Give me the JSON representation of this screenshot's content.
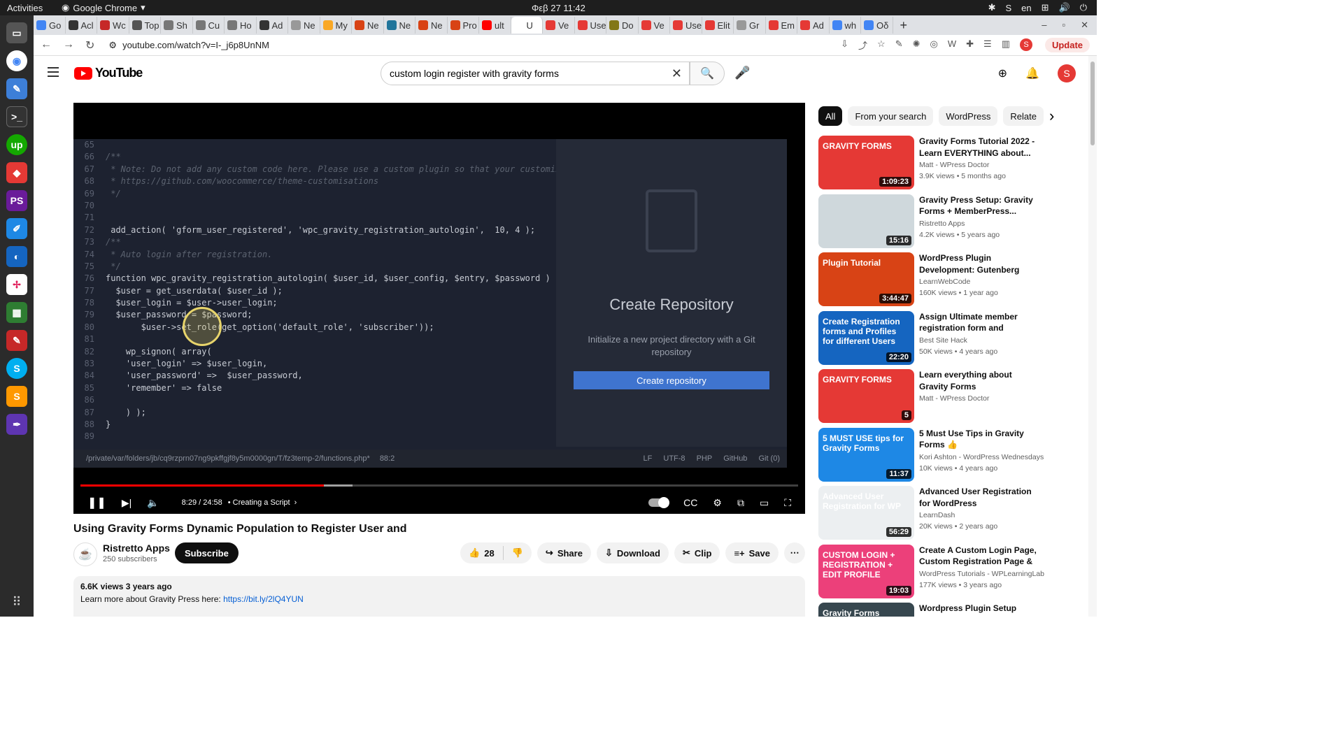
{
  "os": {
    "activities": "Activities",
    "app": "Google Chrome",
    "clock": "Φεβ 27  11:42",
    "lang": "en",
    "user_initial": "S"
  },
  "tabs": [
    {
      "label": "Go",
      "color": "#4285f4"
    },
    {
      "label": "Acl",
      "color": "#333"
    },
    {
      "label": "Wc",
      "color": "#c62828"
    },
    {
      "label": "Top",
      "color": "#555"
    },
    {
      "label": "Sh",
      "color": "#777"
    },
    {
      "label": "Cu",
      "color": "#777"
    },
    {
      "label": "Ho",
      "color": "#777"
    },
    {
      "label": "Ad",
      "color": "#333"
    },
    {
      "label": "Ne",
      "color": "#999"
    },
    {
      "label": "My",
      "color": "#f9a825"
    },
    {
      "label": "Ne",
      "color": "#d84315"
    },
    {
      "label": "Ne",
      "color": "#21759b"
    },
    {
      "label": "Ne",
      "color": "#d84315"
    },
    {
      "label": "Pro",
      "color": "#d84315"
    },
    {
      "label": "ult",
      "color": "#f00"
    },
    {
      "label": "U",
      "color": "#fff",
      "active": true
    },
    {
      "label": "Ve",
      "color": "#e53935"
    },
    {
      "label": "Use",
      "color": "#e53935"
    },
    {
      "label": "Do",
      "color": "#827717"
    },
    {
      "label": "Ve",
      "color": "#e53935"
    },
    {
      "label": "Use",
      "color": "#e53935"
    },
    {
      "label": "Elit",
      "color": "#e53935"
    },
    {
      "label": "Gr",
      "color": "#999"
    },
    {
      "label": "Em",
      "color": "#e53935"
    },
    {
      "label": "Ad",
      "color": "#e53935"
    },
    {
      "label": "wh",
      "color": "#4285f4"
    },
    {
      "label": "Οδ",
      "color": "#4285f4"
    }
  ],
  "browser": {
    "url": "youtube.com/watch?v=I-_j6p8UnNM",
    "profile": "S",
    "update": "Update"
  },
  "youtube": {
    "logo": "YouTube",
    "search_query": "custom login register with gravity forms",
    "avatar": "S"
  },
  "player": {
    "editor": {
      "lines": [
        {
          "n": "65",
          "t": ""
        },
        {
          "n": "66",
          "t": "/**",
          "cls": "c"
        },
        {
          "n": "67",
          "t": " * Note: Do not add any custom code here. Please use a custom plugin so that your customiz",
          "cls": "c"
        },
        {
          "n": "68",
          "t": " * https://github.com/woocommerce/theme-customisations",
          "cls": "c"
        },
        {
          "n": "69",
          "t": " */",
          "cls": "c"
        },
        {
          "n": "70",
          "t": ""
        },
        {
          "n": "71",
          "t": ""
        },
        {
          "n": "72",
          "t": " add_action( 'gform_user_registered', 'wpc_gravity_registration_autologin',  10, 4 );"
        },
        {
          "n": "73",
          "t": "/**",
          "cls": "c"
        },
        {
          "n": "74",
          "t": " * Auto login after registration.",
          "cls": "c"
        },
        {
          "n": "75",
          "t": " */",
          "cls": "c"
        },
        {
          "n": "76",
          "t": "function wpc_gravity_registration_autologin( $user_id, $user_config, $entry, $password ) {"
        },
        {
          "n": "77",
          "t": "  $user = get_userdata( $user_id );"
        },
        {
          "n": "78",
          "t": "  $user_login = $user->user_login;"
        },
        {
          "n": "79",
          "t": "  $user_password = $password;"
        },
        {
          "n": "80",
          "t": "       $user->set_role(get_option('default_role', 'subscriber'));"
        },
        {
          "n": "81",
          "t": ""
        },
        {
          "n": "82",
          "t": "    wp_signon( array("
        },
        {
          "n": "83",
          "t": "    'user_login' => $user_login,"
        },
        {
          "n": "84",
          "t": "    'user_password' =>  $user_password,"
        },
        {
          "n": "85",
          "t": "    'remember' => false"
        },
        {
          "n": "86",
          "t": ""
        },
        {
          "n": "87",
          "t": "    ) );"
        },
        {
          "n": "88",
          "t": "}"
        },
        {
          "n": "89",
          "t": ""
        }
      ],
      "panel_title": "Create Repository",
      "panel_desc": "Initialize a new project directory with a Git repository",
      "panel_button": "Create repository",
      "status_path": "/private/var/folders/jb/cq9rzprn07ng9pkffgjf8y5m0000gn/T/fz3temp-2/functions.php*",
      "status_pos": "88:2",
      "status_items": [
        "LF",
        "UTF-8",
        "PHP",
        "GitHub",
        "Git (0)"
      ]
    },
    "progress": 0.339,
    "time": "8:29 / 24:58",
    "chapter": "• Creating a Script",
    "video_title": "Using Gravity Forms Dynamic Population to Register User and",
    "channel": "Ristretto Apps",
    "subscribers": "250 subscribers",
    "subscribe": "Subscribe",
    "likes": "28",
    "share": "Share",
    "download": "Download",
    "clip": "Clip",
    "save": "Save",
    "views_age": "6.6K views  3 years ago",
    "desc_text": "Learn more about Gravity Press here: ",
    "desc_link": "https://bit.ly/2lQ4YUN"
  },
  "chips": [
    "All",
    "From your search",
    "WordPress",
    "Relate"
  ],
  "recommendations": [
    {
      "title": "Gravity Forms Tutorial 2022 - Learn EVERYTHING about...",
      "channel": "Matt - WPress Doctor",
      "meta": "3.9K views • 5 months ago",
      "duration": "1:09:23",
      "thumb_text": "GRAVITY FORMS",
      "bg": "#e53935"
    },
    {
      "title": "Gravity Press Setup: Gravity Forms + MemberPress...",
      "channel": "Ristretto Apps",
      "meta": "4.2K views • 5 years ago",
      "duration": "15:16",
      "thumb_text": "",
      "bg": "#cfd8dc"
    },
    {
      "title": "WordPress Plugin Development: Gutenberg Blocks, React & More",
      "channel": "LearnWebCode",
      "meta": "160K views • 1 year ago",
      "duration": "3:44:47",
      "thumb_text": "Plugin Tutorial",
      "bg": "#d84315"
    },
    {
      "title": "Assign Ultimate member registration form and ultimate...",
      "channel": "Best Site Hack",
      "meta": "50K views • 4 years ago",
      "duration": "22:20",
      "thumb_text": "Create Registration forms and Profiles for different Users",
      "bg": "#1565c0"
    },
    {
      "title": "Learn everything about Gravity Forms",
      "channel": "Matt - WPress Doctor",
      "meta": "",
      "duration": "5",
      "thumb_text": "GRAVITY FORMS",
      "bg": "#e53935"
    },
    {
      "title": "5 Must Use Tips in Gravity Forms 👍",
      "channel": "Kori Ashton - WordPress Wednesdays",
      "meta": "10K views • 4 years ago",
      "duration": "11:37",
      "thumb_text": "5 MUST USE tips for Gravity Forms",
      "bg": "#1e88e5"
    },
    {
      "title": "Advanced User Registration for WordPress",
      "channel": "LearnDash",
      "meta": "20K views • 2 years ago",
      "duration": "56:29",
      "thumb_text": "Advanced User Registration for WP",
      "bg": "#eceff1"
    },
    {
      "title": "Create A Custom Login Page, Custom Registration Page & A...",
      "channel": "WordPress Tutorials - WPLearningLab",
      "meta": "177K views • 3 years ago",
      "duration": "19:03",
      "thumb_text": "CUSTOM LOGIN + REGISTRATION + EDIT PROFILE",
      "bg": "#ec407a"
    },
    {
      "title": "Wordpress Plugin Setup Tutorial",
      "channel": "",
      "meta": "",
      "duration": "",
      "thumb_text": "Gravity Forms",
      "bg": "#37474f"
    }
  ]
}
